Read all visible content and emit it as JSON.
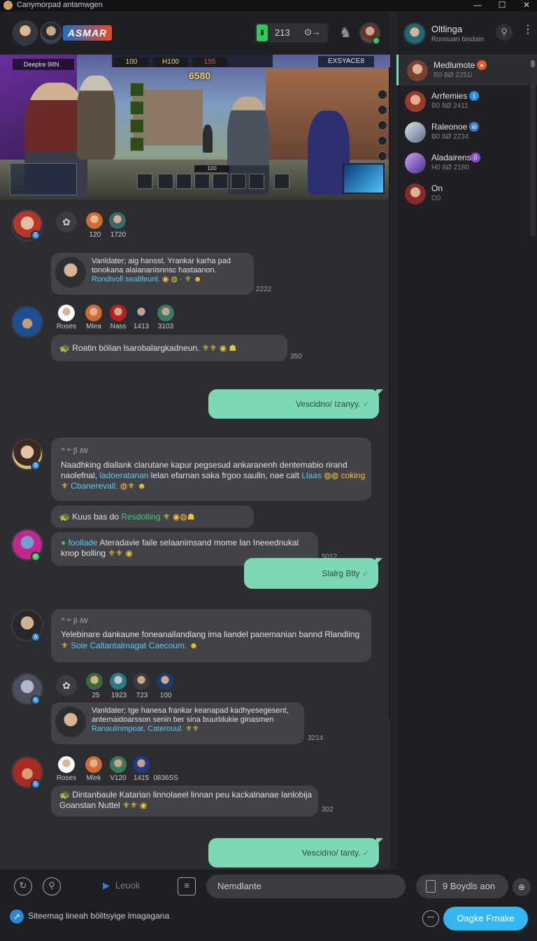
{
  "window": {
    "title": "Canymorpad antamwgen",
    "minimize": "—",
    "maximize": "☐",
    "close": "✕"
  },
  "header": {
    "logo": "ASMAR",
    "stat_value": "213",
    "power": "⊙→",
    "bell": "♞"
  },
  "banner": {
    "pill": "Deeplre  9IIN",
    "hud": [
      "100",
      "H100",
      "155"
    ],
    "brand": "EXSYACE8",
    "score": "6580",
    "timer": "100"
  },
  "sidebar": {
    "channel_name": "Oltlinga",
    "channel_sub": "Ronnuan bisdain",
    "kebab": "⋮",
    "search": "⚲",
    "items": [
      {
        "name": "Medlumote",
        "detail": "B0 8Ø 2251i",
        "badge_color": "#e7552c",
        "badge": "●"
      },
      {
        "name": "Arrfemies",
        "detail": "B0 8Ø 2411",
        "badge_color": "#2d8be0",
        "badge": "1"
      },
      {
        "name": "Raleonoe",
        "detail": "B0 8Ø 2234",
        "badge_color": "#3c7fbf",
        "badge": "⊘"
      },
      {
        "name": "Aladairens",
        "detail": "H0 8Ø 2180",
        "badge_color": "#8d4fd4",
        "badge": "0"
      },
      {
        "name": "On",
        "detail": "O0",
        "badge_color": "",
        "badge": ""
      }
    ]
  },
  "feed": {
    "m1": {
      "mentions": [
        "120",
        "1720"
      ],
      "text1": "Vanldater; aig hansst. Yrankar karha pad",
      "text2": "tonokana alaiananisnnsc hastaanon.",
      "link": "Rondivoll sealifeunl.",
      "emoji": "◉ ◍ · ⚜ ☻",
      "time": "2222"
    },
    "m2": {
      "names": [
        "Roses",
        "Mlea",
        "Nass",
        "1413",
        "3103"
      ],
      "text": "Roatin bölian lsarobalargkadneun.",
      "emoji": "⚜⚜ ◉ ☗",
      "time": "350"
    },
    "o1": {
      "text": "Vescidno/ Izanyy."
    },
    "m3": {
      "header": "ꟸ ꟹ ꞵ ꟿ",
      "text1": "Naadhking diallank clarutane  kapur pegsesud ankaranenh dentemabio rirand",
      "text2": "naolefnal,",
      "link1": "ladoeratanan",
      "text3": "lelan efarnan saka frgoo saulln, nae calt",
      "link2": "Llaas",
      "emoji2": "◍◍ coking",
      "emoji3": "⚜",
      "link3": "Cbanerevall.",
      "emoji4": "◍⚜ ☻"
    },
    "m4": {
      "text": "Kuus bas do",
      "green": "Resdolling",
      "emoji": "⚜ ◉◍☗"
    },
    "m5": {
      "green": "foollade",
      "text1": "Ateradavie faile selaanimsand mome lan Ineeednukal",
      "text2": "knop bolling",
      "emoji": "⚜⚜ ◉",
      "time": "5012"
    },
    "o2": {
      "text": "Slalrg Btly"
    },
    "m6": {
      "header": "ꟸ ꟹ ꞵ ꟿ",
      "text1": "Yelebinare dankaune foneanallandlang ima liandel panemanian bannd Rlandling",
      "emoji1": "⚜",
      "link1": "Sole",
      "link2": "Caltantalmagat",
      "link3": "Caecoum.",
      "emoji3": "☻"
    },
    "m7": {
      "mentions": [
        "25",
        "1923",
        "723",
        "100"
      ],
      "text1": "Vanldater; tge hanesa frankar keanapad kadhyesegesent,",
      "text2": "antemaidoarsson senin ber sina buurblukie ginasmen",
      "link": "Ranaulinmpoat.",
      "link2": "Caterouul.",
      "emoji": "⚜⚜",
      "time": "3214"
    },
    "m8": {
      "names": [
        "Roses",
        "Mlek",
        "V120",
        "1415",
        "0836SS"
      ],
      "text1": "Dintanbaule Katarian linnolaeel linnan peu kackalnanae lanlobija",
      "text2": "Goanstan Nuttel",
      "emoji": "⚜⚜ ◉",
      "time": "302"
    },
    "o3": {
      "text": "Vescidno/ tanty."
    }
  },
  "compose": {
    "level": "Leuok",
    "input": "Nemdlante",
    "button2": "9 Boydls aon",
    "more": "⊕",
    "status": "Siteemag lineah bölitsyige lmagagana",
    "send": "Oagke Frnake",
    "file_icon": "ꟷ"
  },
  "colors": {
    "accent": "#7dd8b6",
    "send": "#34b7f1",
    "link": "#5ec8f0",
    "bg": "#2b2d31"
  }
}
